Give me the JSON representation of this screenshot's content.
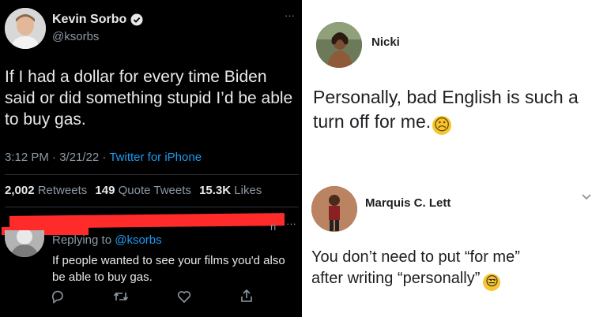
{
  "left_panel": {
    "tweet": {
      "author_name": "Kevin Sorbo",
      "handle": "@ksorbs",
      "more_glyph": "···",
      "text": "If I had a dollar for every time Biden said or did something stupid I’d be able to buy gas.",
      "time": "3:12 PM · 3/21/22 · ",
      "client": "Twitter for iPhone",
      "stats": {
        "retweets_count": "2,002",
        "retweets_label": "Retweets",
        "quotes_count": "149",
        "quotes_label": "Quote Tweets",
        "likes_count": "15.3K",
        "likes_label": "Likes"
      },
      "verified_icon": "verified-badge-icon"
    },
    "reply": {
      "replying_prefix": "Replying to ",
      "replying_handle": "@ksorbs",
      "partial_time": "n",
      "more_glyph": "···",
      "text": "If people wanted to see your films you'd also be able to buy gas.",
      "redaction_color": "#ff2b2b",
      "action_icons": [
        "reply-icon",
        "retweet-icon",
        "like-icon",
        "share-icon"
      ]
    }
  },
  "right_panel": {
    "post1": {
      "author": "Nicki",
      "text": "Personally, bad English is such a turn off for me.",
      "emoji": "☹"
    },
    "post2": {
      "author": "Marquis C. Lett",
      "text": "You don’t need to put “for me” after writing “personally”",
      "emoji": "😒"
    }
  }
}
